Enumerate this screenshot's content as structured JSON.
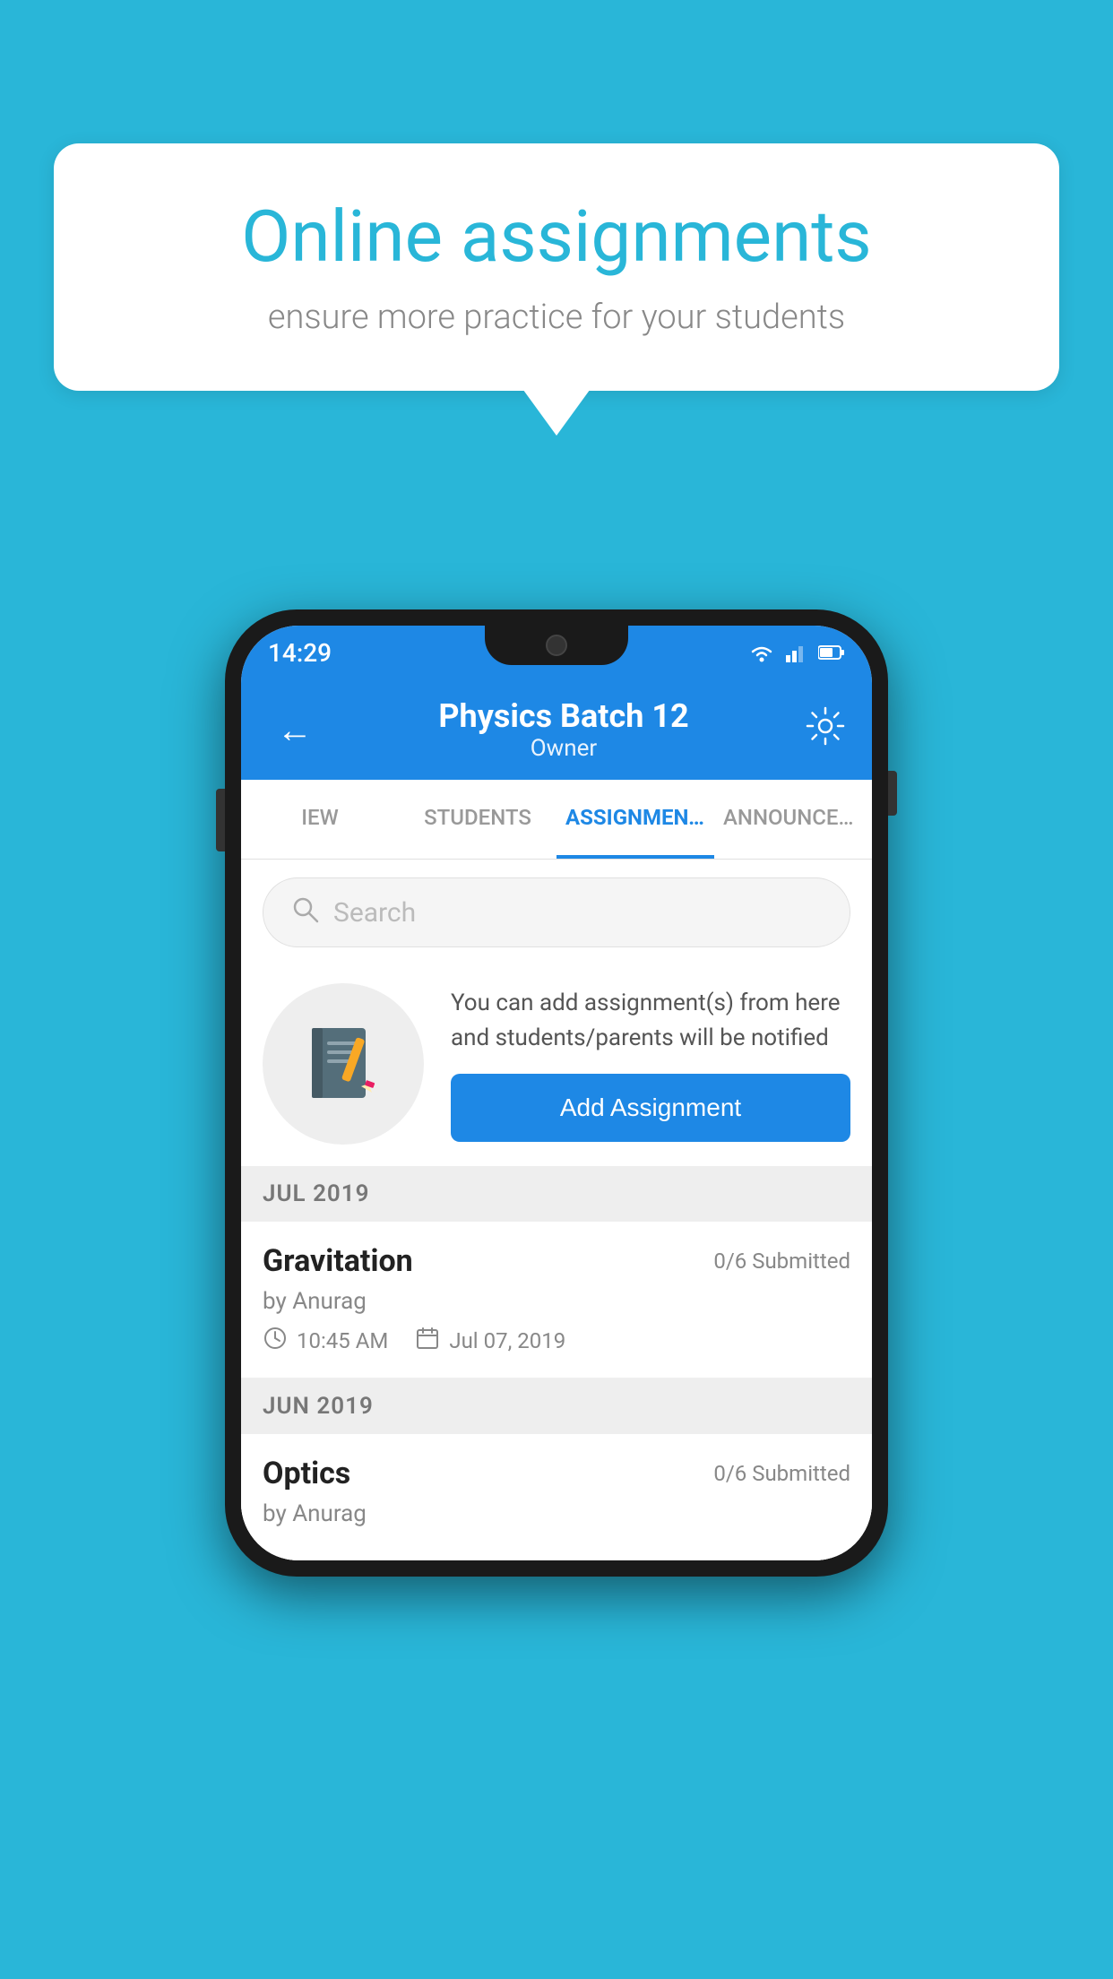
{
  "background_color": "#29b6d8",
  "speech_bubble": {
    "title": "Online assignments",
    "subtitle": "ensure more practice for your students"
  },
  "status_bar": {
    "time": "14:29",
    "wifi": "▼",
    "signal": "▲▲",
    "battery": "▐"
  },
  "app_header": {
    "title": "Physics Batch 12",
    "subtitle": "Owner",
    "back_label": "←",
    "settings_label": "⚙"
  },
  "tabs": [
    {
      "label": "IEW",
      "active": false
    },
    {
      "label": "STUDENTS",
      "active": false
    },
    {
      "label": "ASSIGNMENTS",
      "active": true
    },
    {
      "label": "ANNOUNCEM...",
      "active": false
    }
  ],
  "search": {
    "placeholder": "Search"
  },
  "promo": {
    "description": "You can add assignment(s) from here and students/parents will be notified",
    "button_label": "Add Assignment"
  },
  "sections": [
    {
      "header": "JUL 2019",
      "assignments": [
        {
          "title": "Gravitation",
          "submitted": "0/6 Submitted",
          "by": "by Anurag",
          "time": "10:45 AM",
          "date": "Jul 07, 2019"
        }
      ]
    },
    {
      "header": "JUN 2019",
      "assignments": [
        {
          "title": "Optics",
          "submitted": "0/6 Submitted",
          "by": "by Anurag",
          "time": "",
          "date": ""
        }
      ]
    }
  ]
}
